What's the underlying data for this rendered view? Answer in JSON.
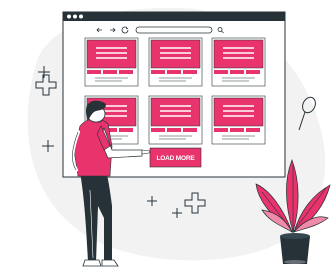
{
  "browser": {
    "nav_icons": [
      "back-arrow-icon",
      "forward-arrow-icon",
      "reload-icon",
      "search-icon"
    ],
    "window_dots": 3
  },
  "load_more_button": {
    "label": "LOAD MORE"
  },
  "colors": {
    "accent": "#e8336d",
    "ink": "#263238",
    "blob": "#f2f2f2",
    "card_line": "#f7c8d6"
  }
}
